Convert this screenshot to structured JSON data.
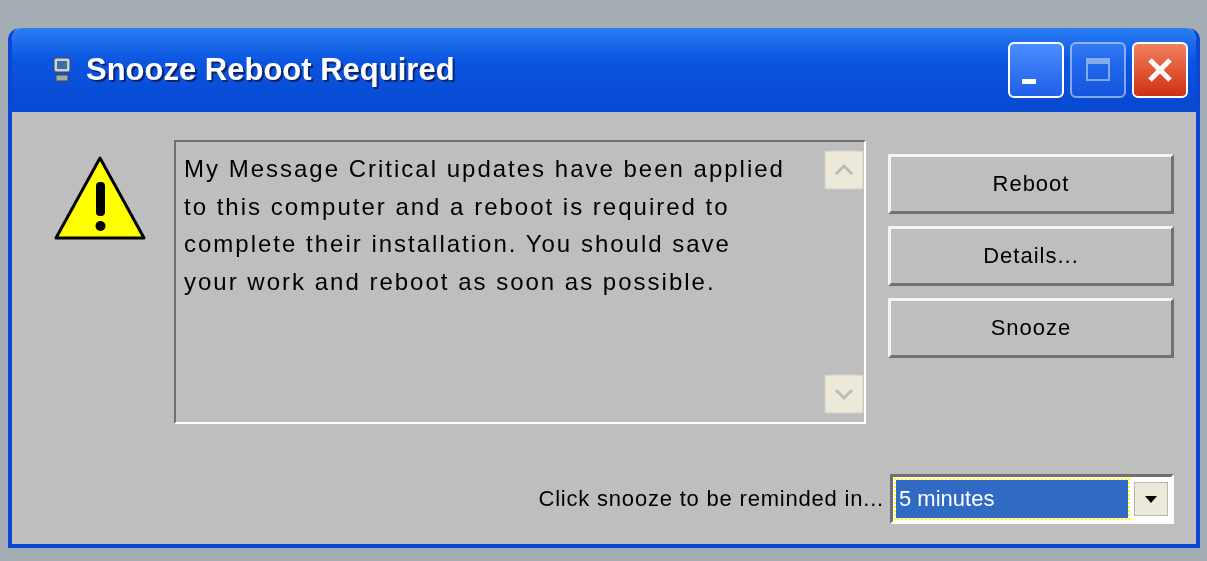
{
  "window": {
    "title": "Snooze Reboot Required"
  },
  "controls": [
    {
      "kind": "minimize",
      "disabled": false
    },
    {
      "kind": "maximize",
      "disabled": true
    },
    {
      "kind": "close",
      "disabled": false
    }
  ],
  "message": "My Message Critical updates have been applied to this computer and a reboot is required to complete their installation.  You should save your work and reboot as soon as possible.",
  "buttons": [
    {
      "label": "Reboot"
    },
    {
      "label": "Details..."
    },
    {
      "label": "Snooze"
    }
  ],
  "snooze": {
    "label": "Click snooze to be reminded in...",
    "value": "5 minutes",
    "selected": true
  }
}
